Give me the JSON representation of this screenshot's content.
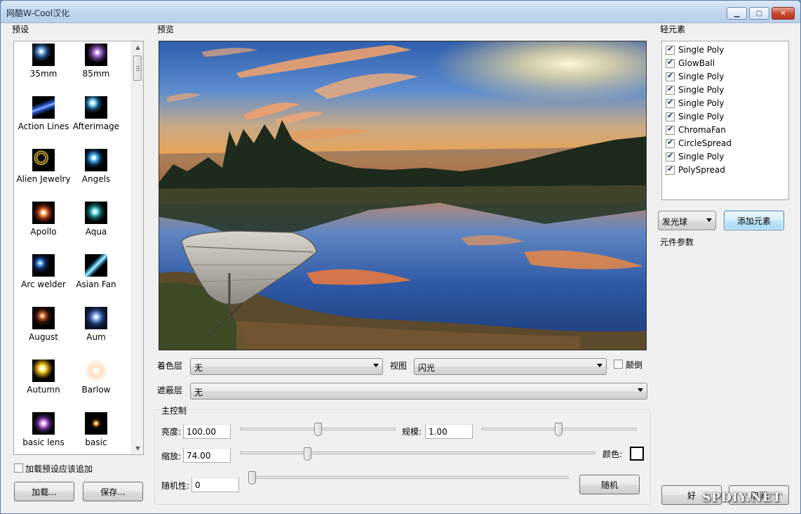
{
  "window": {
    "title": "网酷W-Cool汉化",
    "min": "▁",
    "max": "▢",
    "close": "✕"
  },
  "presets": {
    "label": "预设",
    "items": [
      {
        "label": "35mm",
        "icon": "lens-flare-35mm-thumb"
      },
      {
        "label": "85mm",
        "icon": "lens-flare-85mm-thumb"
      },
      {
        "label": "Action Lines",
        "icon": "action-lines-thumb"
      },
      {
        "label": "Afterimage",
        "icon": "afterimage-thumb"
      },
      {
        "label": "Alien Jewelry",
        "icon": "alien-jewelry-thumb"
      },
      {
        "label": "Angels",
        "icon": "angels-thumb"
      },
      {
        "label": "Apollo",
        "icon": "apollo-thumb"
      },
      {
        "label": "Aqua",
        "icon": "aqua-thumb"
      },
      {
        "label": "Arc welder",
        "icon": "arc-welder-thumb"
      },
      {
        "label": "Asian Fan",
        "icon": "asian-fan-thumb"
      },
      {
        "label": "August",
        "icon": "august-thumb"
      },
      {
        "label": "Aum",
        "icon": "aum-thumb"
      },
      {
        "label": "Autumn",
        "icon": "autumn-thumb"
      },
      {
        "label": "Barlow",
        "icon": "barlow-thumb"
      },
      {
        "label": "basic lens",
        "icon": "basic-lens-thumb"
      },
      {
        "label": "basic",
        "icon": "basic-thumb"
      }
    ],
    "append_checkbox_label": "加载预设应该追加",
    "load_button": "加载...",
    "save_button": "保存..."
  },
  "preview": {
    "label": "预览",
    "color_layer_label": "着色层",
    "color_layer_value": "无",
    "view_label": "视图",
    "view_value": "闪光",
    "invert_label": "颠倒",
    "mask_layer_label": "遮蔽层",
    "mask_layer_value": "无"
  },
  "master": {
    "label": "主控制",
    "brightness_label": "亮度:",
    "brightness_value": "100.00",
    "scale_label": "规模:",
    "scale_value": "1.00",
    "zoom_label": "缩放:",
    "zoom_value": "74.00",
    "color_label": "颜色:",
    "color_value": "#ffffff",
    "random_label": "随机性:",
    "random_value": "0",
    "random_button": "随机"
  },
  "lite": {
    "label": "轻元素",
    "items": [
      {
        "label": "Single Poly",
        "checked": true
      },
      {
        "label": "GlowBall",
        "checked": true
      },
      {
        "label": "Single Poly",
        "checked": true
      },
      {
        "label": "Single Poly",
        "checked": true
      },
      {
        "label": "Single Poly",
        "checked": true
      },
      {
        "label": "Single Poly",
        "checked": true
      },
      {
        "label": "ChromaFan",
        "checked": true
      },
      {
        "label": "CircleSpread",
        "checked": true
      },
      {
        "label": "Single Poly",
        "checked": true
      },
      {
        "label": "PolySpread",
        "checked": true
      }
    ],
    "element_type_value": "发光球",
    "add_button": "添加元素",
    "params_label": "元件参数"
  },
  "footer": {
    "ok_button": "好",
    "cancel_button": "取消"
  },
  "watermark": "SPDIY.NET"
}
